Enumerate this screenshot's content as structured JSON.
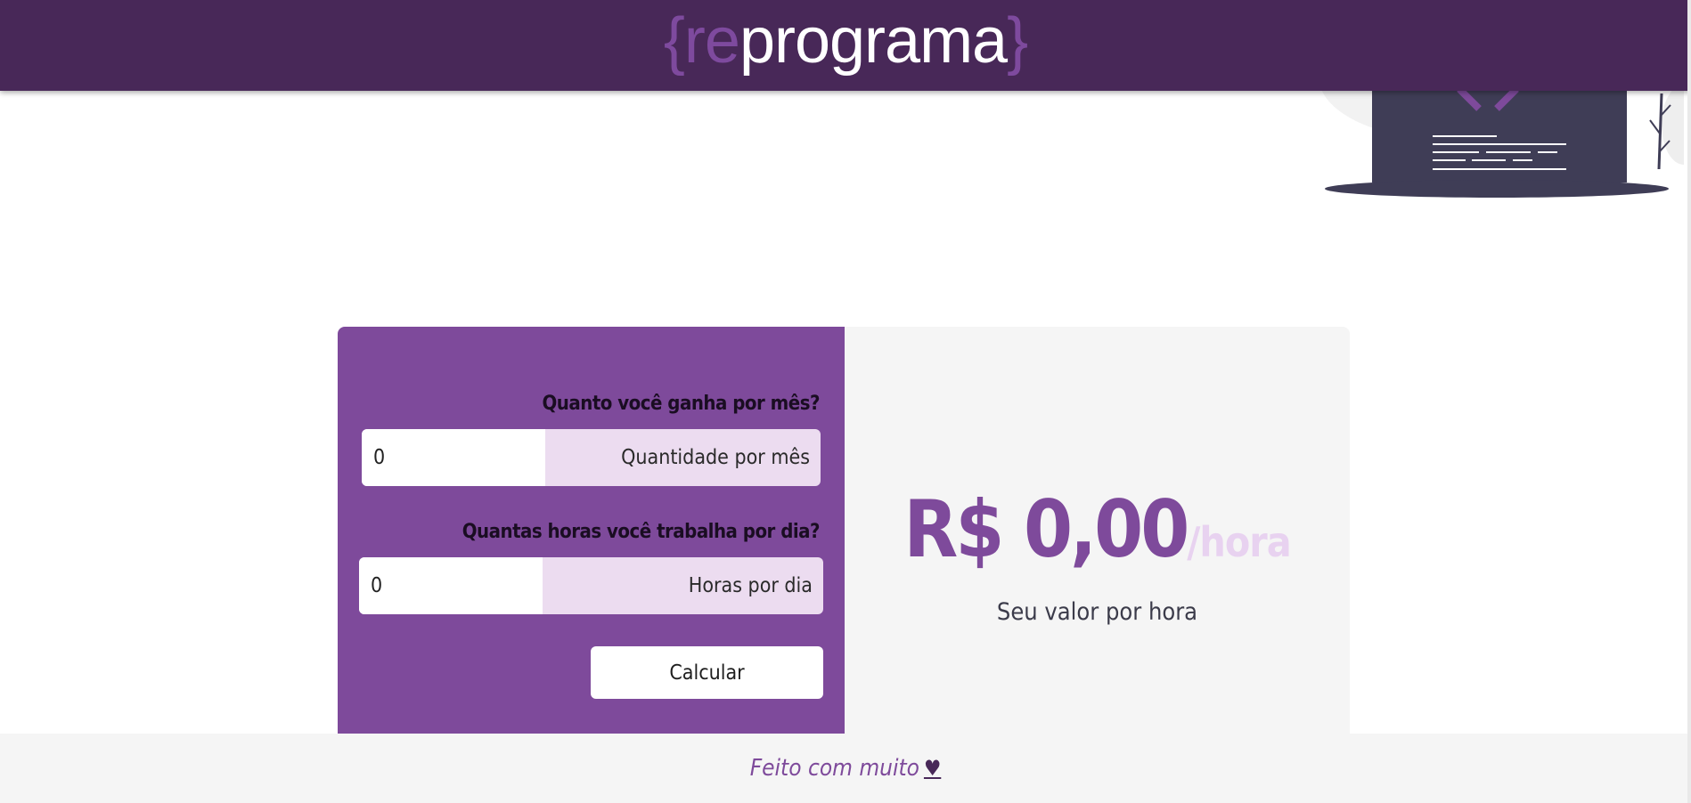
{
  "header": {
    "logo": {
      "open_brace": "{",
      "re": "re",
      "rest": "programa",
      "close_brace": "}"
    }
  },
  "form": {
    "monthly": {
      "question": "Quanto você ganha por mês?",
      "value": "0",
      "addon": "Quantidade por mês"
    },
    "hours": {
      "question": "Quantas horas você trabalha por dia?",
      "value": "0",
      "addon": "Horas por dia"
    },
    "submit_label": "Calcular"
  },
  "result": {
    "amount": "R$ 0,00",
    "unit": "/hora",
    "caption": "Seu valor por hora"
  },
  "footer": {
    "text": "Feito com muito",
    "heart": "♥"
  },
  "icons": {
    "heart": "heart-icon",
    "illustration": "laptop-code-illustration"
  },
  "colors": {
    "header_bg": "#482858",
    "accent": "#7e4a9b",
    "panel_bg": "#f5f5f5",
    "addon_bg": "#ecdcf0"
  }
}
